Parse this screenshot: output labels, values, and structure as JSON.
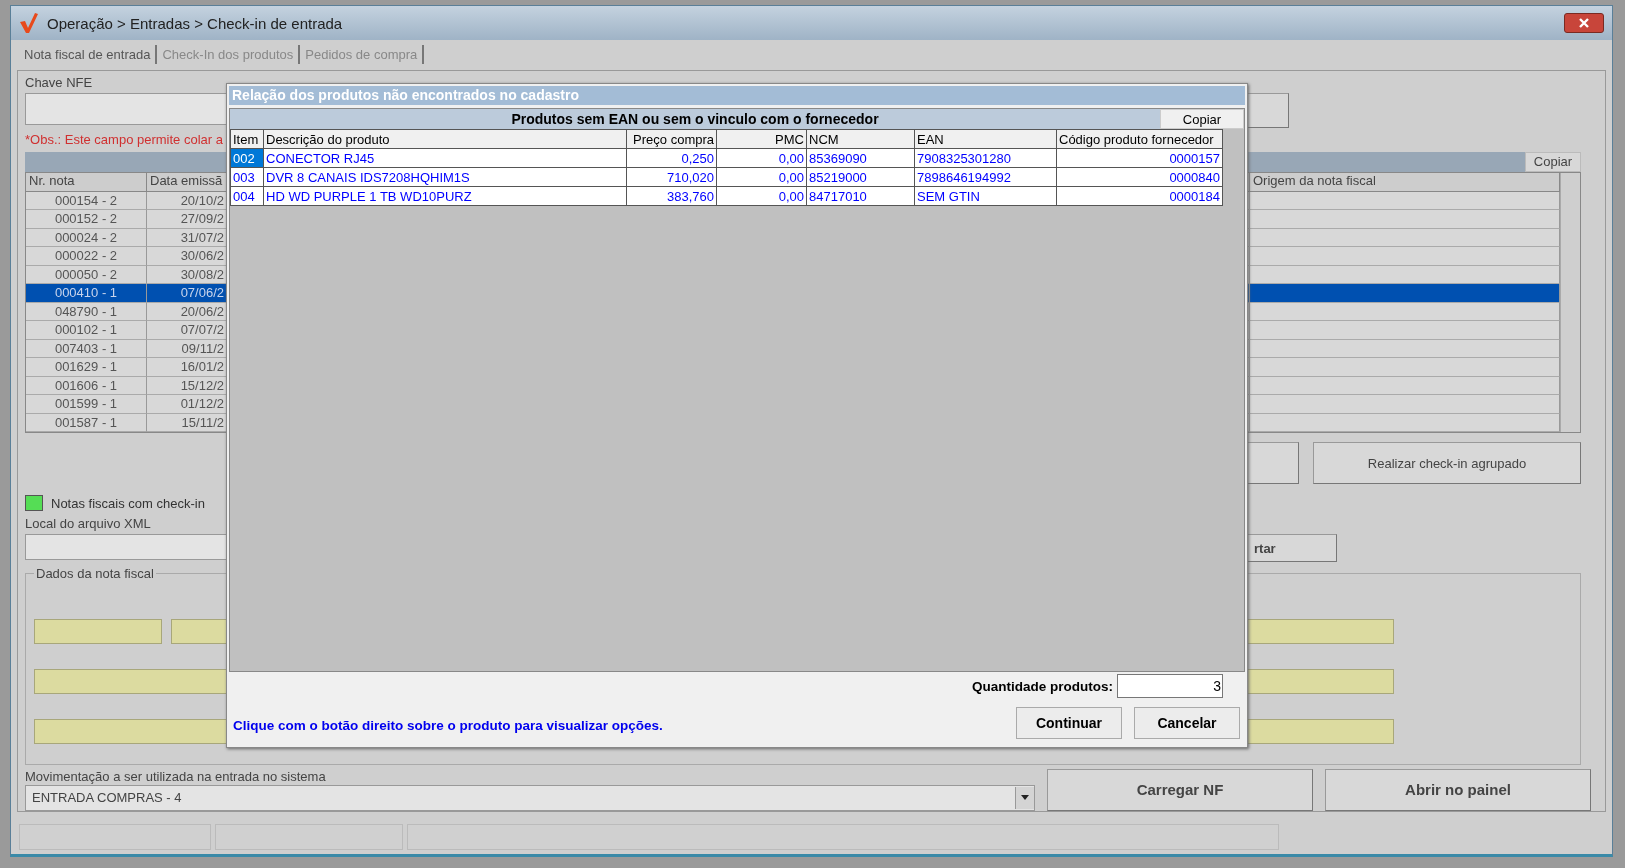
{
  "window": {
    "title": "Operação > Entradas > Check-in de entrada"
  },
  "tabs": [
    {
      "label": "Nota fiscal de entrada",
      "selected": true
    },
    {
      "label": "Check-In dos produtos",
      "selected": false
    },
    {
      "label": "Pedidos de compra",
      "selected": false
    }
  ],
  "main": {
    "chave_nfe_label": "Chave NFE",
    "obs_note": "*Obs.: Este campo permite colar a",
    "notes_table": {
      "copy_button": "Copiar",
      "columns": [
        "Nr. nota",
        "Data emissã",
        "Origem da nota fiscal"
      ],
      "rows": [
        {
          "nr": "000154 - 2",
          "date": "20/10/2",
          "selected": false
        },
        {
          "nr": "000152 - 2",
          "date": "27/09/2",
          "selected": false
        },
        {
          "nr": "000024 - 2",
          "date": "31/07/2",
          "selected": false
        },
        {
          "nr": "000022 - 2",
          "date": "30/06/2",
          "selected": false
        },
        {
          "nr": "000050 - 2",
          "date": "30/08/2",
          "selected": false
        },
        {
          "nr": "000410 - 1",
          "date": "07/06/2",
          "selected": true
        },
        {
          "nr": "048790 - 1",
          "date": "20/06/2",
          "selected": false
        },
        {
          "nr": "000102 - 1",
          "date": "07/07/2",
          "selected": false
        },
        {
          "nr": "007403 - 1",
          "date": "09/11/2",
          "selected": false
        },
        {
          "nr": "001629 - 1",
          "date": "16/01/2",
          "selected": false
        },
        {
          "nr": "001606 - 1",
          "date": "15/12/2",
          "selected": false
        },
        {
          "nr": "001599 - 1",
          "date": "01/12/2",
          "selected": false
        },
        {
          "nr": "001587 - 1",
          "date": "15/11/2",
          "selected": false
        }
      ]
    },
    "grouped_checkin_button": "Realizar check-in agrupado",
    "legend": {
      "label": "Notas fiscais com check-in",
      "color": "#55dd55"
    },
    "xml_location_label": "Local do arquivo XML",
    "import_button": "rtar",
    "invoice_group_title": "Dados da nota fiscal",
    "movement": {
      "label": "Movimentação a ser utilizada na entrada no sistema",
      "value": "ENTRADA COMPRAS - 4"
    },
    "action_buttons": [
      "Carregar NF",
      "Abrir no painel"
    ]
  },
  "dialog": {
    "title": "Relação dos produtos não encontrados no cadastro",
    "band_title": "Produtos sem EAN ou sem o vinculo com o fornecedor",
    "copy_button": "Copiar",
    "columns": [
      "Item",
      "Descrição do produto",
      "Preço compra",
      "PMC",
      "NCM",
      "EAN",
      "Código produto fornecedor"
    ],
    "rows": [
      {
        "cells": [
          "002",
          "CONECTOR RJ45",
          "0,250",
          "0,00",
          "85369090",
          "7908325301280",
          "0000157"
        ],
        "selected": true
      },
      {
        "cells": [
          "003",
          "DVR 8 CANAIS IDS7208HQHIM1S",
          "710,020",
          "0,00",
          "85219000",
          "7898646194992",
          "0000840"
        ],
        "selected": false
      },
      {
        "cells": [
          "004",
          "HD WD PURPLE 1 TB WD10PURZ",
          "383,760",
          "0,00",
          "84717010",
          "SEM GTIN",
          "0000184"
        ],
        "selected": false
      }
    ],
    "quantity": {
      "label": "Quantidade produtos:",
      "value": "3"
    },
    "hint": "Clique com o botão direito sobre o produto para visualizar opções.",
    "buttons": [
      "Continuar",
      "Cancelar"
    ]
  }
}
